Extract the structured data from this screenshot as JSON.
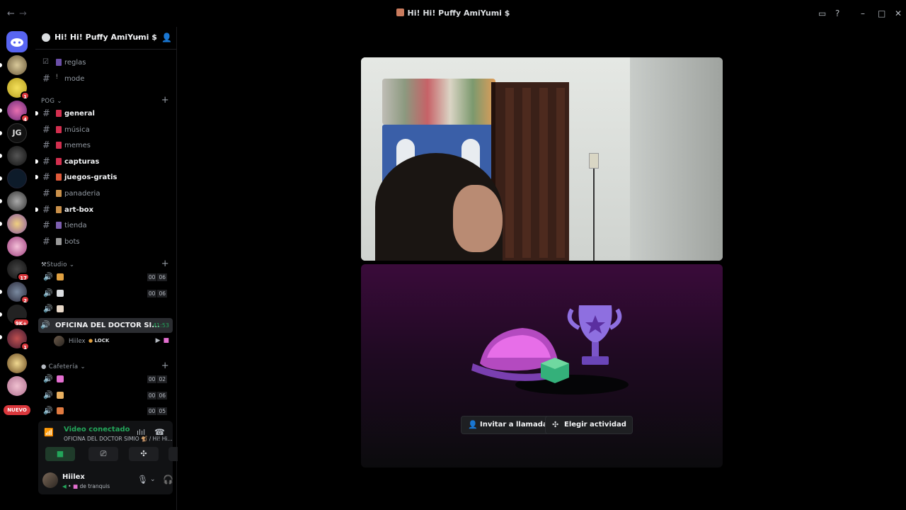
{
  "window": {
    "title": "Hi! Hi! Puffy AmiYumi $",
    "back": "←",
    "forward": "→"
  },
  "rail": {
    "badges": [
      "1",
      "4",
      "17",
      "2",
      "9K+",
      "1"
    ],
    "new_label": "NUEVO"
  },
  "server": {
    "name": "Hi! Hi! Puffy AmiYumi $"
  },
  "channels_top": [
    {
      "name": "reglas",
      "emoji_color": "#6b4fa8",
      "unread": false,
      "icon": "checkbox-icon"
    },
    {
      "name": "mode",
      "emoji_color": "#888888",
      "unread": false,
      "icon": "hash-icon"
    }
  ],
  "categories": {
    "pog": "POG",
    "studio": "Studio",
    "cafeteria": "Cafetería"
  },
  "pog_channels": [
    {
      "name": "general",
      "emoji_color": "#d32f4f",
      "unread": true
    },
    {
      "name": "música",
      "emoji_color": "#d32f4f",
      "unread": false
    },
    {
      "name": "memes",
      "emoji_color": "#d32f4f",
      "unread": false
    },
    {
      "name": "capturas",
      "emoji_color": "#d32f4f",
      "unread": true
    },
    {
      "name": "juegos-gratis",
      "emoji_color": "#e05a3a",
      "unread": true
    },
    {
      "name": "panaderia",
      "emoji_color": "#c9904a",
      "unread": false
    },
    {
      "name": "art-box",
      "emoji_color": "#c9904a",
      "unread": true
    },
    {
      "name": "tienda",
      "emoji_color": "#7d5fb0",
      "unread": false
    },
    {
      "name": "bots",
      "emoji_color": "#999999",
      "unread": false
    }
  ],
  "studio_voice": [
    {
      "emoji_color": "#e0a040",
      "count_a": "00",
      "count_b": "06"
    },
    {
      "emoji_color": "#dbdee1",
      "count_a": "00",
      "count_b": "06"
    },
    {
      "emoji_color": "#e8d8c8",
      "count_a": "",
      "count_b": ""
    }
  ],
  "active_voice": {
    "name": "OFICINA DEL DOCTOR SI...",
    "timer": "41:53"
  },
  "voice_user": {
    "name": "Hiilex",
    "tag": "LOCK"
  },
  "cafeteria_voice": [
    {
      "emoji_color": "#e46fd0",
      "count_a": "00",
      "count_b": "02"
    },
    {
      "emoji_color": "#e8b060",
      "count_a": "00",
      "count_b": "06"
    },
    {
      "emoji_color": "#e07a40",
      "count_a": "00",
      "count_b": "05"
    }
  ],
  "voice_panel": {
    "status": "Video conectado",
    "channel": "OFICINA DEL DOCTOR SIMIO 🐒 / Hi! Hi..."
  },
  "user": {
    "name": "Hiilex",
    "status": "de tranquis"
  },
  "activity": {
    "invite_label": "Invitar a llamada",
    "choose_label": "Elegir actividad"
  },
  "colors": {
    "accent_green": "#23a55a",
    "badge_red": "#da373c"
  }
}
